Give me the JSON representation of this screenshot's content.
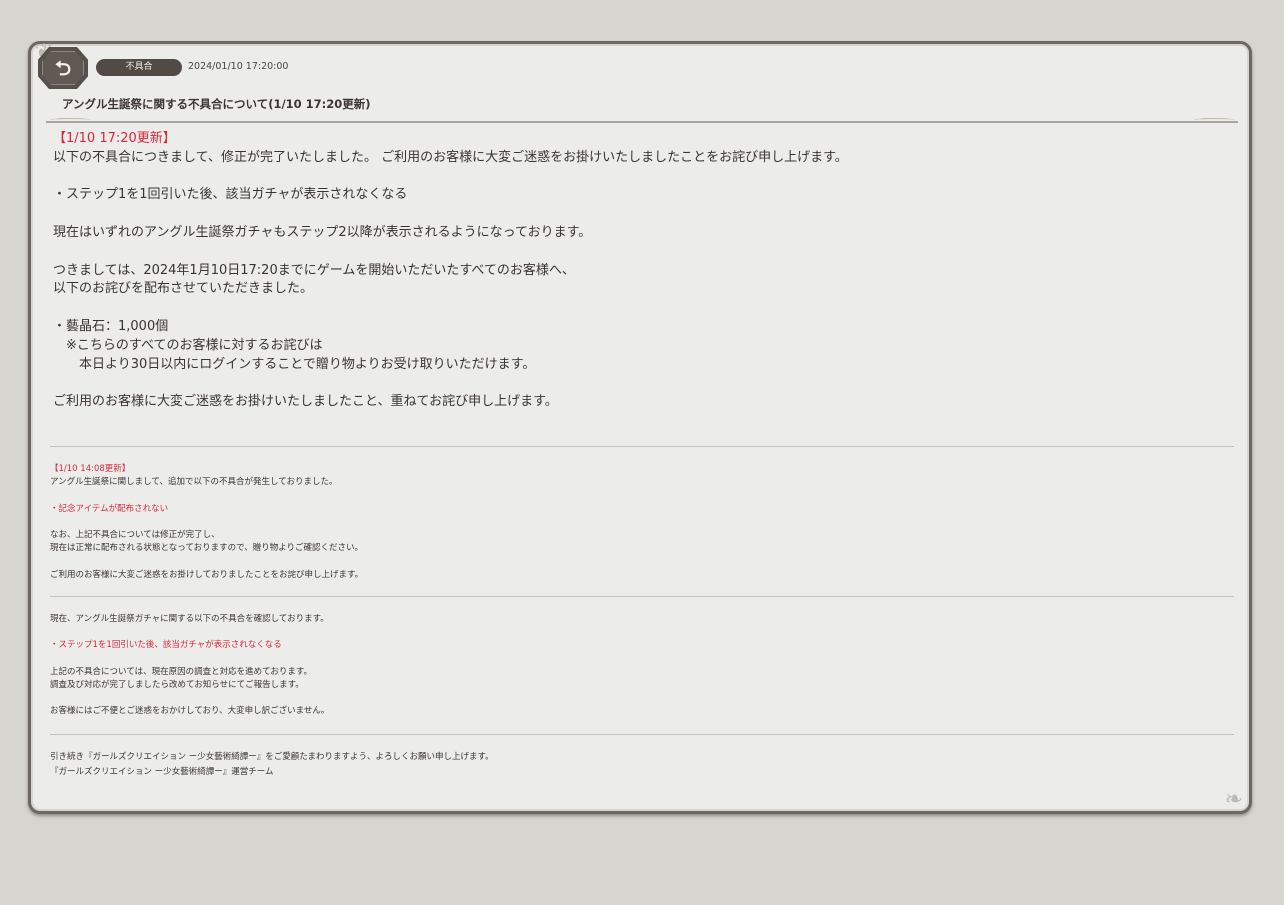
{
  "header": {
    "category": "不具合",
    "date": "2024/01/10 17:20:00",
    "title": "アングル生誕祭に関する不具合について(1/10 17:20更新)"
  },
  "update_1720": {
    "heading": "【1/10 17:20更新】",
    "line1": "以下の不具合につきまして、修正が完了いたしました。 ご利用のお客様に大変ご迷惑をお掛けいたしましたことをお詫び申し上げます。",
    "bullet": "・ステップ1を1回引いた後、該当ガチャが表示されなくなる",
    "line2": "現在はいずれのアングル生誕祭ガチャもステップ2以降が表示されるようになっております。",
    "line3": "つきましては、2024年1月10日17:20までにゲームを開始いただいたすべてのお客様へ、",
    "line4": "以下のお詫びを配布させていただきました。",
    "reward": "・藝晶石：1,000個",
    "reward_note1": "※こちらのすべてのお客様に対するお詫びは",
    "reward_note2": "本日より30日以内にログインすることで贈り物よりお受け取りいただけます。",
    "closing": "ご利用のお客様に大変ご迷惑をお掛けいたしましたこと、重ねてお詫び申し上げます。"
  },
  "update_1408": {
    "heading": "【1/10 14:08更新】",
    "line1": "アングル生誕祭に関しまして、追加で以下の不具合が発生しておりました。",
    "bullet": "・記念アイテムが配布されない",
    "line2": "なお、上記不具合については修正が完了し、",
    "line3": "現在は正常に配布される状態となっておりますので、贈り物よりご確認ください。",
    "closing": "ご利用のお客様に大変ご迷惑をお掛けしておりましたことをお詫び申し上げます。"
  },
  "initial": {
    "line1": "現在、アングル生誕祭ガチャに関する以下の不具合を確認しております。",
    "bullet": "・ステップ1を1回引いた後、該当ガチャが表示されなくなる",
    "line2": "上記の不具合については、現在原因の調査と対応を進めております。",
    "line3": "調査及び対応が完了しましたら改めてお知らせにてご報告します。",
    "closing": "お客様にはご不便とご迷惑をおかけしており、大変申し訳ございません。"
  },
  "footer": {
    "line1": "引き続き『ガールズクリエイション ー少女藝術綺譚ー』をご愛顧たまわりますよう、よろしくお願い申し上げます。",
    "line2": "『ガールズクリエイション ー少女藝術綺譚ー』運営チーム"
  },
  "icons": {
    "back": "back-arrow-icon"
  },
  "colors": {
    "accent_red": "#d8283a",
    "badge": "#514a45",
    "panel_border": "#6e6660"
  }
}
